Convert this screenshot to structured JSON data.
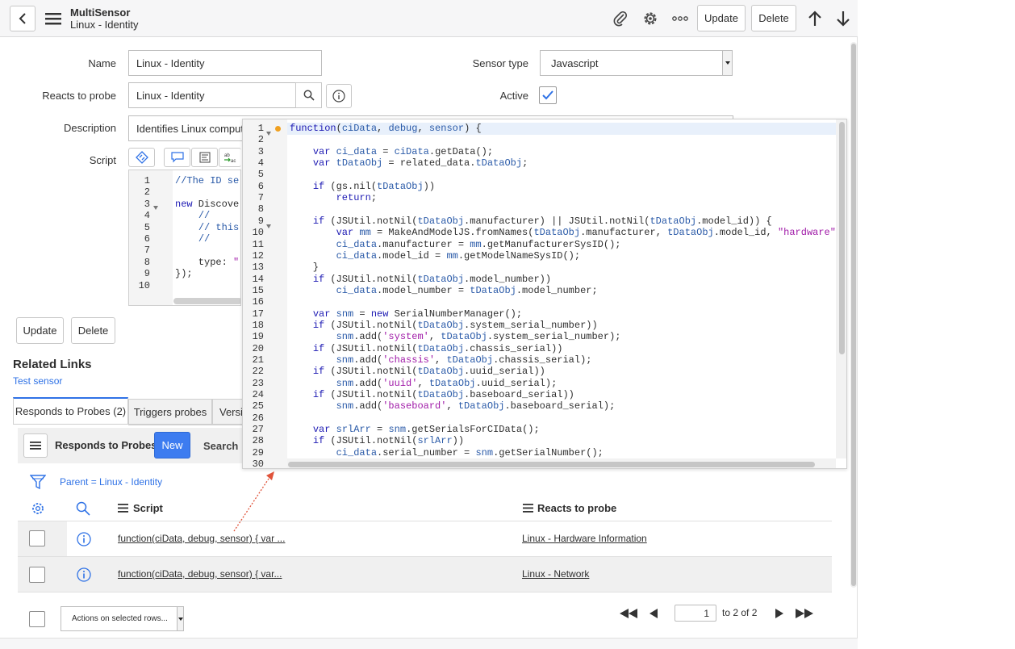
{
  "header": {
    "title": "MultiSensor",
    "subtitle": "Linux - Identity",
    "update_label": "Update",
    "delete_label": "Delete"
  },
  "form": {
    "name_label": "Name",
    "name_value": "Linux - Identity",
    "sensor_type_label": "Sensor type",
    "sensor_type_value": "Javascript",
    "reacts_label": "Reacts to probe",
    "reacts_value": "Linux - Identity",
    "active_label": "Active",
    "active_checked": true,
    "description_label": "Description",
    "description_value": "Identifies Linux compute",
    "script_label": "Script",
    "update_label": "Update",
    "delete_label": "Delete"
  },
  "mini_editor": {
    "lines": [
      {
        "n": "1",
        "text": "//The ID se"
      },
      {
        "n": "2",
        "text": ""
      },
      {
        "n": "3",
        "text": "new Discove"
      },
      {
        "n": "4",
        "text": "    //"
      },
      {
        "n": "5",
        "text": "    // this"
      },
      {
        "n": "6",
        "text": "    //"
      },
      {
        "n": "7",
        "text": ""
      },
      {
        "n": "8",
        "text": "    type: \""
      },
      {
        "n": "9",
        "text": "});"
      },
      {
        "n": "10",
        "text": ""
      }
    ]
  },
  "popup_editor": {
    "line_numbers": [
      "1",
      "2",
      "3",
      "4",
      "5",
      "6",
      "7",
      "8",
      "9",
      "10",
      "11",
      "12",
      "13",
      "14",
      "15",
      "16",
      "17",
      "18",
      "19",
      "20",
      "21",
      "22",
      "23",
      "24",
      "25",
      "26",
      "27",
      "28",
      "29",
      "30"
    ],
    "code": [
      "function(ciData, debug, sensor) {",
      "",
      "    var ci_data = ciData.getData();",
      "    var tDataObj = related_data.tDataObj;",
      "",
      "    if (gs.nil(tDataObj))",
      "        return;",
      "",
      "    if (JSUtil.notNil(tDataObj.manufacturer) || JSUtil.notNil(tDataObj.model_id)) {",
      "        var mm = MakeAndModelJS.fromNames(tDataObj.manufacturer, tDataObj.model_id, \"hardware\"",
      "        ci_data.manufacturer = mm.getManufacturerSysID();",
      "        ci_data.model_id = mm.getModelNameSysID();",
      "    }",
      "    if (JSUtil.notNil(tDataObj.model_number))",
      "        ci_data.model_number = tDataObj.model_number;",
      "",
      "    var snm = new SerialNumberManager();",
      "    if (JSUtil.notNil(tDataObj.system_serial_number))",
      "        snm.add('system', tDataObj.system_serial_number);",
      "    if (JSUtil.notNil(tDataObj.chassis_serial))",
      "        snm.add('chassis', tDataObj.chassis_serial);",
      "    if (JSUtil.notNil(tDataObj.uuid_serial))",
      "        snm.add('uuid', tDataObj.uuid_serial);",
      "    if (JSUtil.notNil(tDataObj.baseboard_serial))",
      "        snm.add('baseboard', tDataObj.baseboard_serial);",
      "",
      "    var srlArr = snm.getSerialsForCIData();",
      "    if (JSUtil.notNil(srlArr))",
      "        ci_data.serial_number = snm.getSerialNumber();",
      ""
    ]
  },
  "related_links": {
    "heading": "Related Links",
    "test_sensor": "Test sensor"
  },
  "tabs": [
    {
      "label": "Responds to Probes (2)"
    },
    {
      "label": "Triggers probes"
    },
    {
      "label": "Versi"
    }
  ],
  "list": {
    "title": "Responds to Probes",
    "new_label": "New",
    "search_label": "Search",
    "filter_text": "Parent = Linux - Identity",
    "col_script": "Script",
    "col_reacts": "Reacts to probe",
    "rows": [
      {
        "script": "function(ciData, debug, sensor) { var ...",
        "reacts": "Linux - Hardware Information"
      },
      {
        "script": "function(ciData, debug, sensor) { var...",
        "reacts": "Linux - Network"
      }
    ],
    "actions_label": "Actions on selected rows...",
    "page_value": "1",
    "page_of": "to 2 of 2"
  },
  "colors": {
    "accent": "#2f72e6",
    "link": "#2f72e6",
    "header_bg": "#f6f6f7"
  }
}
